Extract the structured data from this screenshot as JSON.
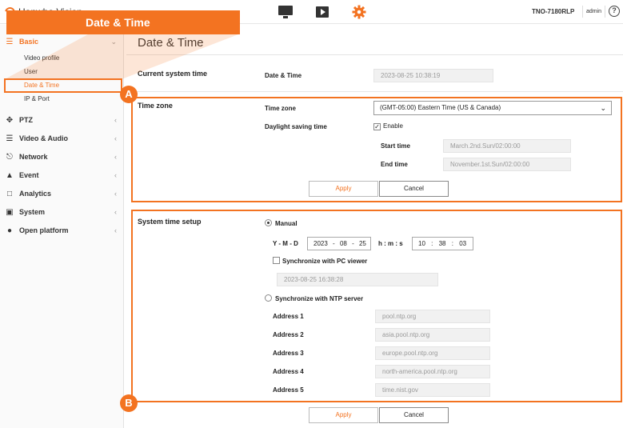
{
  "header": {
    "brand": "Hanwha Vision",
    "model": "TNO-7180RLP",
    "user": "admin",
    "help_glyph": "?",
    "icons": [
      "monitor-icon",
      "play-icon",
      "gear-icon"
    ],
    "accent_color": "#f37321"
  },
  "callout": {
    "title": "Date & Time"
  },
  "badges": {
    "a": "A",
    "b": "B"
  },
  "sidebar": {
    "groups": [
      {
        "label": "Basic",
        "icon": "list-icon",
        "expanded": true
      },
      {
        "label": "PTZ",
        "icon": "move-icon"
      },
      {
        "label": "Video & Audio",
        "icon": "sliders-icon"
      },
      {
        "label": "Network",
        "icon": "network-icon"
      },
      {
        "label": "Event",
        "icon": "bell-icon"
      },
      {
        "label": "Analytics",
        "icon": "frame-icon"
      },
      {
        "label": "System",
        "icon": "system-icon"
      },
      {
        "label": "Open platform",
        "icon": "platform-icon"
      }
    ],
    "basic_items": [
      "Video profile",
      "User",
      "Date & Time",
      "IP & Port"
    ],
    "active_item": "Date & Time"
  },
  "page": {
    "title": "Date & Time"
  },
  "current_time": {
    "section": "Current system time",
    "label": "Date & Time",
    "value": "2023-08-25 10:38:19"
  },
  "time_zone": {
    "section": "Time zone",
    "zone_label": "Time zone",
    "zone_value": "(GMT-05:00) Eastern Time (US & Canada)",
    "dst_label": "Daylight saving time",
    "dst_enable": "Enable",
    "dst_checked": true,
    "start_label": "Start time",
    "start_value": "March.2nd.Sun/02:00:00",
    "end_label": "End time",
    "end_value": "November.1st.Sun/02:00:00",
    "apply": "Apply",
    "cancel": "Cancel"
  },
  "time_setup": {
    "section": "System time setup",
    "manual": "Manual",
    "ymd_label": "Y - M - D",
    "year": "2023",
    "month": "08",
    "day": "25",
    "date_sep": "-",
    "hms_label": "h : m : s",
    "hour": "10",
    "minute": "38",
    "second": "03",
    "time_sep": ":",
    "sync_pc": "Synchronize with PC viewer",
    "pc_time": "2023-08-25 16:38:28",
    "sync_ntp": "Synchronize with NTP server",
    "addresses": [
      {
        "label": "Address 1",
        "value": "pool.ntp.org"
      },
      {
        "label": "Address 2",
        "value": "asia.pool.ntp.org"
      },
      {
        "label": "Address 3",
        "value": "europe.pool.ntp.org"
      },
      {
        "label": "Address 4",
        "value": "north-america.pool.ntp.org"
      },
      {
        "label": "Address 5",
        "value": "time.nist.gov"
      }
    ],
    "apply": "Apply",
    "cancel": "Cancel"
  }
}
